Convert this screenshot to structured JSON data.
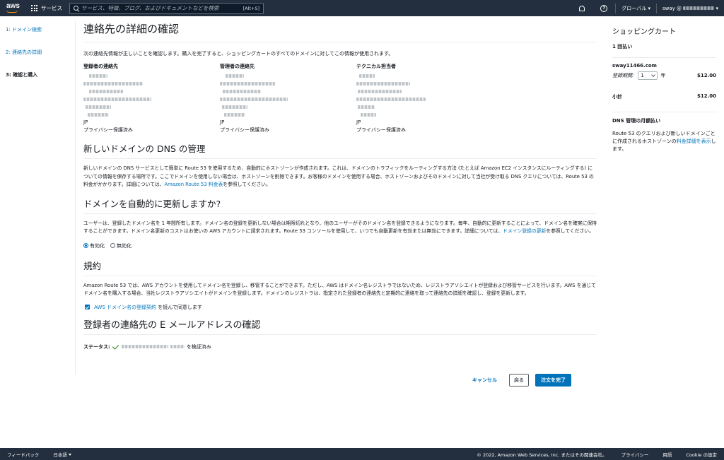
{
  "topnav": {
    "logo": "aws",
    "services_label": "サービス",
    "search_placeholder": "サービス、特徴、ブログ、およびドキュメントなどを検索",
    "search_shortcut": "[Alt+S]",
    "region": "グローバル",
    "account_prefix": "sway @"
  },
  "steps": [
    {
      "label": "1: ドメイン検索"
    },
    {
      "label": "2: 連絡先の詳細"
    },
    {
      "label": "3: 確認と購入"
    }
  ],
  "main": {
    "title": "連絡先の詳細の確認",
    "intro": "次の連絡先情報が正しいことを確認します。購入を完了すると、ショッピングカートのすべてのドメインに対してこの情報が使用されます。",
    "contacts": [
      {
        "title": "登録者の連絡先",
        "country": "JP",
        "privacy": "プライバシー保護済み"
      },
      {
        "title": "管理者の連絡先",
        "country": "JP",
        "privacy": "プライバシー保護済み"
      },
      {
        "title": "テクニカル担当者",
        "country": "JP",
        "privacy": "プライバシー保護済み"
      }
    ],
    "dns": {
      "title": "新しいドメインの DNS の管理",
      "text": "新しいドメインの DNS サービスとして簡単に Route 53 を使用するため、自動的にホストゾーンが作成されます。これは、ドメインのトラフィックをルーティングする方法 (たとえば Amazon EC2 インスタンスにルーティングする) についての情報を保存する場所です。ここでドメインを使用しない場合は、ホストゾーンを削除できます。お客様のドメインを使用する場合、ホストゾーンおよびそのドメインに対して当社が受け取る DNS クエリについては、Route 53 の料金がかかります。詳細については、",
      "link": "Amazon Route 53 料金表",
      "tail": "を参照してください。"
    },
    "renew": {
      "title": "ドメインを自動的に更新しますか?",
      "text": "ユーザーは、登録したドメイン名を 1 年間所有します。ドメイン名の登録を更新しない場合は期限切れとなり、他のユーザーがそのドメイン名を登録できるようになります。毎年、自動的に更新することによって、ドメイン名を確実に保持することができます。ドメイン名更新のコストはお使いの AWS アカウントに請求されます。Route 53 コンソールを使用して、いつでも自動更新を有効または無効にできます。詳細については、",
      "link": "ドメイン登録の更新",
      "tail": "を参照してください。",
      "enable": "有効化",
      "disable": "無効化"
    },
    "terms": {
      "title": "規約",
      "text": "Amazon Route 53 では、AWS アカウントを使用してドメイン名を登録し、移管することができます。ただし、AWS はドメイン名レジストラではないため、レジストラアソシエイトが登録および移管サービスを行います。AWS を通じてドメイン名を購入する場合、当社レジストラアソシエイトがドメインを登録します。ドメインのレジストラは、指定された登録者の連絡先と定期的に連絡を取って連絡先の詳細を確認し、登録を更新します。",
      "agree_link": "AWS ドメイン名の登録契約",
      "agree_tail": "を読んで同意します"
    },
    "email": {
      "title": "登録者の連絡先の E メールアドレスの確認",
      "status_label": "ステータス:",
      "status_tail": "を検証済み"
    },
    "actions": {
      "cancel": "キャンセル",
      "back": "戻る",
      "complete": "注文を完了"
    }
  },
  "cart": {
    "title": "ショッピングカート",
    "payment": "1 回払い",
    "domain": "sway11466.com",
    "period_label": "登録期間:",
    "period_value": "1",
    "period_unit": "年",
    "price": "$12.00",
    "subtotal_label": "小計",
    "subtotal": "$12.00",
    "dns_title": "DNS 管理の月額払い",
    "dns_text": "Route 53 のクエリおよび新しいドメインごとに作成されるホストゾーンの",
    "dns_link": "料金詳細を表示",
    "dns_tail": "します。"
  },
  "footer": {
    "feedback": "フィードバック",
    "language": "日本語",
    "copyright": "© 2022, Amazon Web Services, Inc. またはその関連会社。",
    "privacy": "プライバシー",
    "terms": "用語",
    "cookie": "Cookie の設定"
  }
}
